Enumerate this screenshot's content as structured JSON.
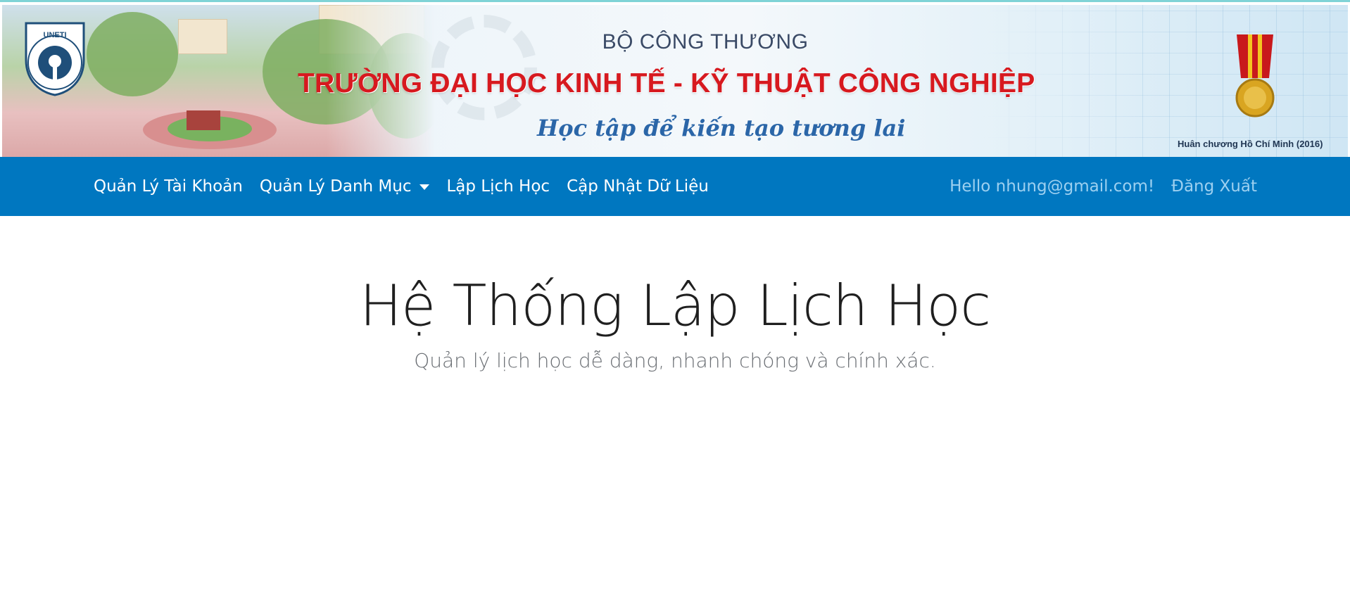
{
  "banner": {
    "logo_text": "UNETI",
    "logo_ring_text": "TRƯỜNG ĐẠI HỌC KINH TẾ - KỸ THUẬT CÔNG NGHIỆP",
    "ministry": "BỘ CÔNG THƯƠNG",
    "school_name": "TRƯỜNG ĐẠI HỌC KINH TẾ - KỸ THUẬT CÔNG NGHIỆP",
    "slogan": "Học tập để kiến tạo tương lai",
    "medal_caption": "Huân chương Hồ Chí Minh (2016)",
    "school_color": "#d7191f",
    "slogan_color": "#2b66a8"
  },
  "navbar": {
    "background": "#0077c0",
    "items": [
      {
        "label": "Quản Lý Tài Khoản"
      },
      {
        "label": "Quản Lý Danh Mục",
        "has_dropdown": true,
        "icon": "caret-down-icon"
      },
      {
        "label": "Lập Lịch Học"
      },
      {
        "label": "Cập Nhật Dữ Liệu"
      }
    ],
    "greeting": "Hello nhung@gmail.com!",
    "logout": "Đăng Xuất"
  },
  "hero": {
    "title": "Hệ Thống Lập Lịch Học",
    "subtitle": "Quản lý lịch học dễ dàng, nhanh chóng và chính xác."
  }
}
